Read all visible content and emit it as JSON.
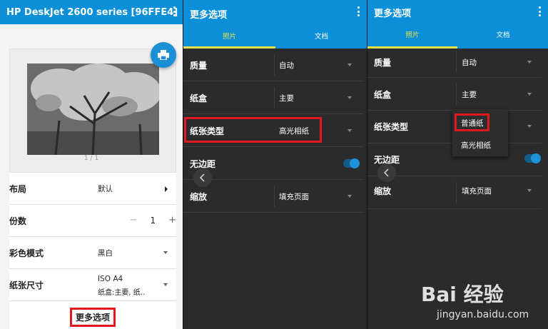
{
  "panel1": {
    "title": "HP DeskJet 2600 series [96FFE4]",
    "page_count": "1 / 1",
    "rows": [
      {
        "label": "布局",
        "value": "默认"
      },
      {
        "label": "份数",
        "value": "1"
      },
      {
        "label": "彩色模式",
        "value": "黑白"
      },
      {
        "label": "纸张尺寸",
        "value": "ISO A4",
        "sub": "纸盒:主要, 纸‥"
      }
    ],
    "more_button": "更多选项",
    "stepper_minus": "−",
    "stepper_plus": "+"
  },
  "panel2": {
    "title": "更多选项",
    "tabs": [
      "照片",
      "文档"
    ],
    "active_tab": 0,
    "rows": [
      {
        "label": "质量",
        "value": "自动"
      },
      {
        "label": "纸盒",
        "value": "主要"
      },
      {
        "label": "纸张类型",
        "value": "高光相纸"
      },
      {
        "label": "无边距",
        "value": ""
      },
      {
        "label": "缩放",
        "value": "填充页面"
      }
    ],
    "borderless_on": true
  },
  "panel3": {
    "title": "更多选项",
    "tabs": [
      "照片",
      "文档"
    ],
    "active_tab": 0,
    "rows": [
      {
        "label": "质量",
        "value": "自动"
      },
      {
        "label": "纸盒",
        "value": "主要"
      },
      {
        "label": "纸张类型",
        "value": ""
      },
      {
        "label": "无边距",
        "value": ""
      },
      {
        "label": "缩放",
        "value": "填充页面"
      }
    ],
    "dropdown_options": [
      "普通纸",
      "高光相纸"
    ],
    "borderless_on": true
  },
  "watermark": {
    "main": "Bai 经验",
    "sub": "jingyan.baidu.com"
  },
  "colors": {
    "header_blue": "#0a8fd8",
    "tab_active": "#e8e14b",
    "highlight_red": "#e0191e",
    "dark_bg": "#2b2b2b"
  }
}
